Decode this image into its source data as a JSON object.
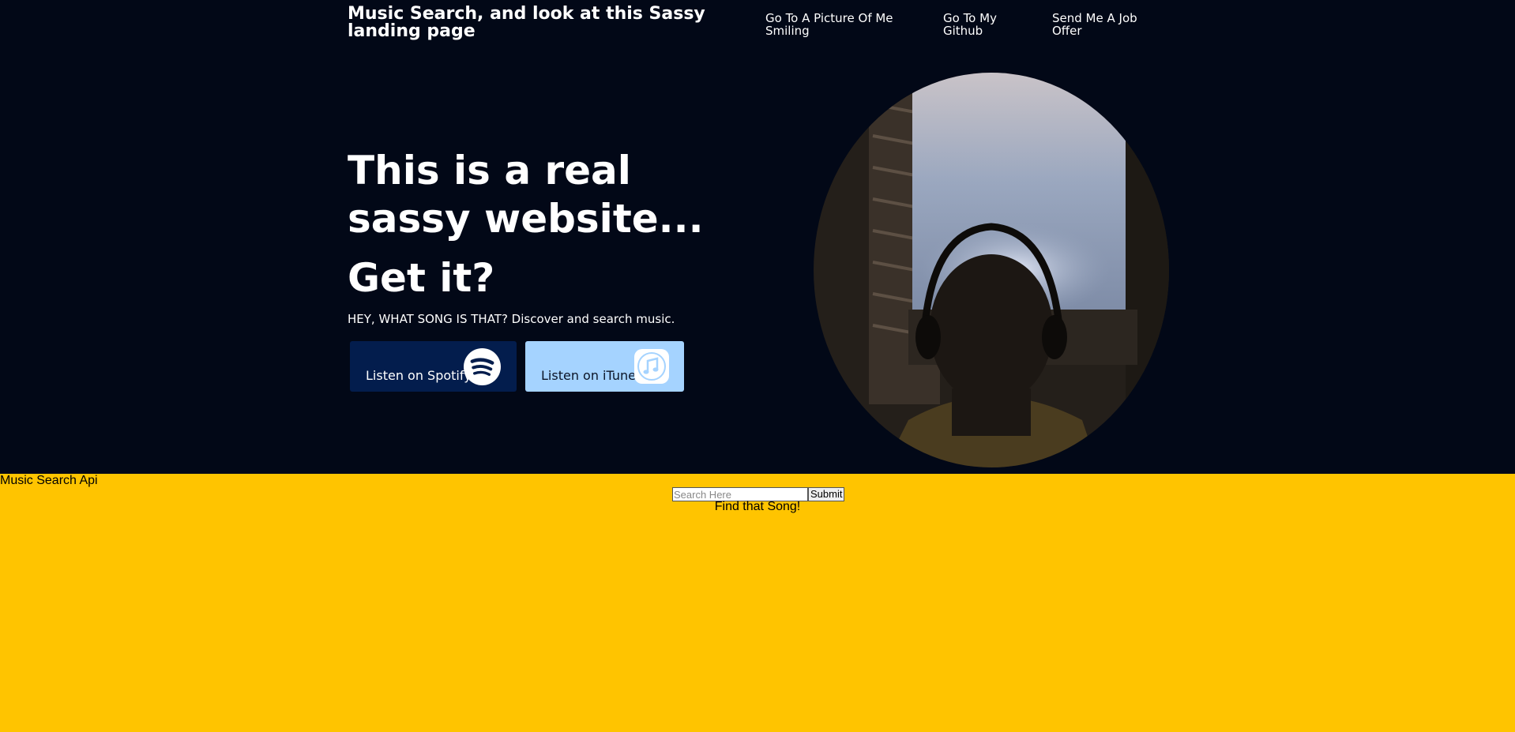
{
  "header": {
    "title": "Music Search, and look at this Sassy landing page",
    "nav": [
      "Go To A Picture Of Me Smiling",
      "Go To My Github",
      "Send Me A Job Offer"
    ]
  },
  "hero": {
    "headline": "This is a real sassy website...",
    "subhead": "Get it?",
    "tagline": "HEY, WHAT SONG IS THAT? Discover and search music.",
    "buttons": {
      "spotify": {
        "label": "Listen on Spotify",
        "icon": "spotify-icon"
      },
      "itunes": {
        "label": "Listen on iTunes",
        "icon": "itunes-icon"
      }
    },
    "image": "person-with-headphones-at-window"
  },
  "search": {
    "section_title": "Music Search Api",
    "placeholder": "Search Here",
    "value": "",
    "submit_label": "Submit",
    "caption": "Find that Song!"
  },
  "colors": {
    "hero_bg": "#020817",
    "search_bg": "#ffc400",
    "spotify_button": "#031d4d",
    "itunes_button": "#a5d3ff"
  }
}
